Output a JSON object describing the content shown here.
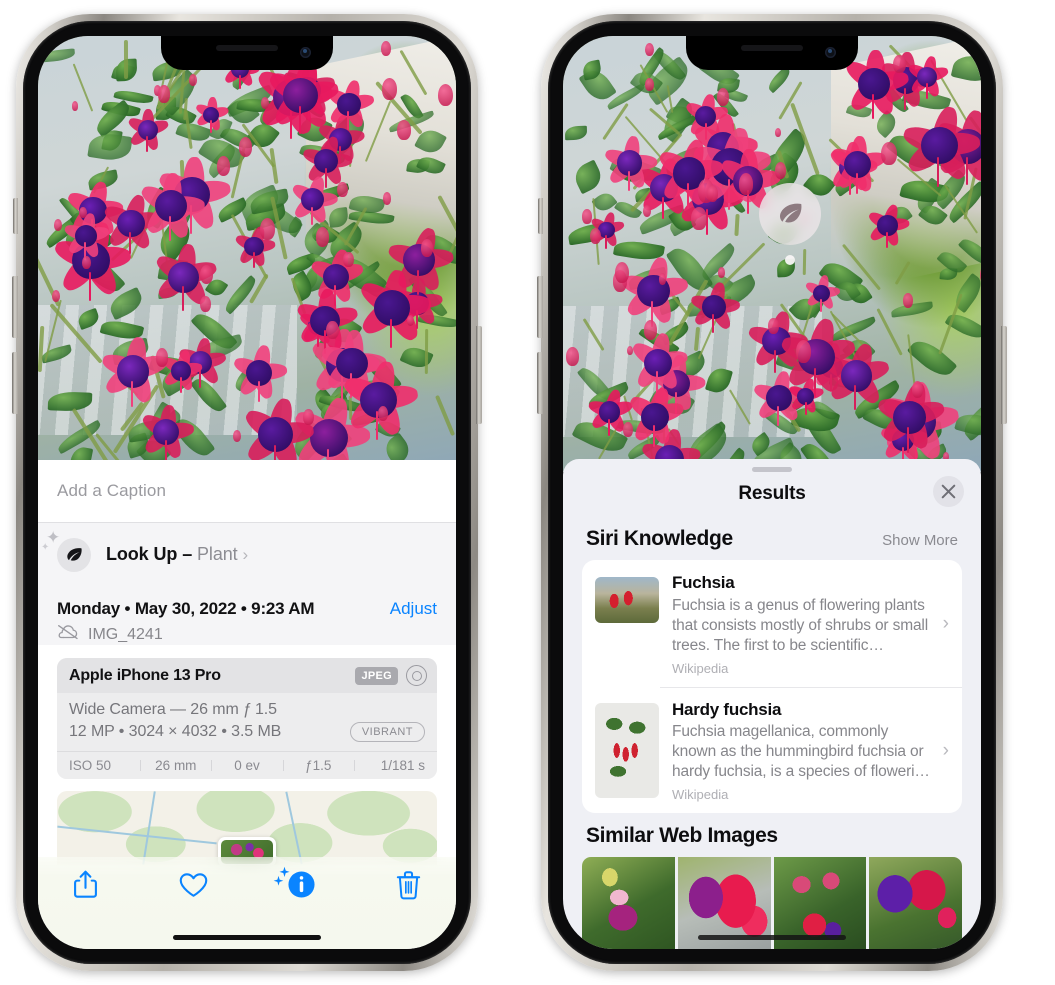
{
  "left_phone": {
    "caption": {
      "placeholder": "Add a Caption"
    },
    "lookup": {
      "icon": "leaf-icon",
      "label": "Look Up –",
      "subject": "Plant",
      "chevron": "›"
    },
    "meta": {
      "date": "Monday • May 30, 2022 • 9:23 AM",
      "adjust_label": "Adjust",
      "filename": "IMG_4241",
      "cloud_icon": "icloud-slash-icon"
    },
    "exif_card": {
      "device": "Apple iPhone 13 Pro",
      "format_tag": "JPEG",
      "aperture_icon": "aperture-icon",
      "lens_line": "Wide Camera — 26 mm ƒ 1.5",
      "size_line": "12 MP • 3024 × 4032 • 3.5 MB",
      "style_tag": "VIBRANT",
      "stats": [
        "ISO 50",
        "26 mm",
        "0 ev",
        "ƒ1.5",
        "1/181 s"
      ]
    },
    "toolbar": [
      {
        "name": "share-button",
        "icon": "share-icon"
      },
      {
        "name": "favorite-button",
        "icon": "heart-icon"
      },
      {
        "name": "info-button",
        "icon": "info-sparkle-icon"
      },
      {
        "name": "delete-button",
        "icon": "trash-icon"
      }
    ],
    "accent_color": "#0a84ff"
  },
  "right_phone": {
    "vlu_badge": {
      "icon": "leaf-icon"
    },
    "sheet": {
      "title": "Results",
      "close_label": "✕",
      "sections": [
        {
          "title": "Siri Knowledge",
          "action": "Show More",
          "items": [
            {
              "title": "Fuchsia",
              "description": "Fuchsia is a genus of flowering plants that consists mostly of shrubs or small trees. The first to be scientific…",
              "source": "Wikipedia",
              "chevron": "›"
            },
            {
              "title": "Hardy fuchsia",
              "description": "Fuchsia magellanica, commonly known as the hummingbird fuchsia or hardy fuchsia, is a species of floweri…",
              "source": "Wikipedia",
              "chevron": "›"
            }
          ]
        },
        {
          "title": "Similar Web Images",
          "items": [
            {
              "name": "similar-image-1"
            },
            {
              "name": "similar-image-2"
            },
            {
              "name": "similar-image-3"
            },
            {
              "name": "similar-image-4"
            }
          ]
        }
      ]
    }
  }
}
